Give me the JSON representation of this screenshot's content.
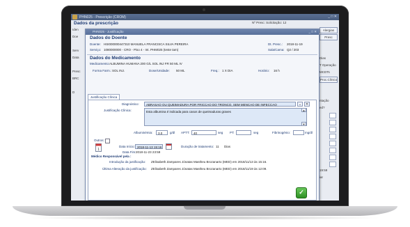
{
  "background_window": {
    "title": "PHN025 - Prescrição (CROM)",
    "header": "Dados da prescrição",
    "top_label": "Nº Presc: Solicitação: 12",
    "left_items": [
      "Iden",
      "Doe",
      "",
      "Serv",
      "Data",
      "",
      "Presc",
      "BRC",
      "",
      "D"
    ],
    "right_items": [
      "Alergias",
      "Presc",
      "",
      "",
      "Dias",
      "T Operação",
      "MCDTs",
      "Proc.Clínico",
      "",
      "",
      "ntação",
      "ed?"
    ],
    "right_bottom": [
      "19:59",
      "iar"
    ]
  },
  "modal": {
    "title": "PHN025 - Justificação",
    "patient_section": {
      "title": "Dados do Doente",
      "patient_label": "Doente:",
      "patient_value": "HSI000000447310 MANUELA FRANCISCA SILVA PEREIRA",
      "date_label": "Dt. Presc.:",
      "date_value": "2018-11-19",
      "service_label": "Serviço:",
      "service_value": "1080000000 - CRO - Piso 4 - Int. PHM025 (teste tam)",
      "room_label": "Sala/Cama:",
      "room_value": "Q2 / 203"
    },
    "medication_section": {
      "title": "Dados do Medicamento",
      "med_label": "Medicamento:",
      "med_value": "ALBUMINA HUMANA 200 G/L SOL INJ FR 50 ML IV",
      "form_label": "Forma Farm.:",
      "form_value": "SOL INJ.",
      "dose_label": "Dose/Unidade:",
      "dose_value": "50 ML",
      "freq_label": "Freq.:",
      "freq_value": "1 X DIA",
      "time_label": "Horário:",
      "time_value": "16 h"
    },
    "tab_label": "Justificação Clínica",
    "diagnosis_label": "Diagnóstico:",
    "diagnosis_value": "ABRASAO OU QUEIMADURA POR FRICCAO DO TRONCO, SEM MENCAO DE INFECCAO",
    "justification_label": "Justificação Clínica:",
    "justification_value": "Esta albumina é indicada para casos de queimaduras graves",
    "labs": {
      "albumin_label": "Albuminémia:",
      "albumin_value": "3.0",
      "albumin_unit": "g/dl",
      "aptt_label": "APTT:",
      "aptt_value": "40",
      "aptt_unit": "seg",
      "pt_label": "PT:",
      "pt_value": "",
      "pt_unit": "seg",
      "fibrinogen_label": "Fibrinogénio:",
      "fibrinogen_value": "",
      "fibrinogen_unit": "mg/dl"
    },
    "others_label": "Outros:",
    "start_label": "Data Início:",
    "start_value": "2018-11-13 15:16",
    "duration_label": "Duração de tratamento:",
    "duration_value": "11",
    "duration_unit": "Dias",
    "end_label": "Data Fim:",
    "end_value": "2018-11-23 23:59",
    "responsible_label": "Médico Responsável pela :",
    "intro_label": "Introdução da justificação:",
    "intro_value": "ZElisabeth Zampares Jónatas Mastheu Brozanarto (MED)  em 2018/11/13 às 15:16.",
    "last_change_label": "Última Alteração da justificação:",
    "last_change_value": "ZElisabeth Zampares Jónatas Mastheu Brozanarto (MED)  em 2018/11/19 às 12:09.",
    "ok_icon": "check-icon",
    "window_controls": "_ □ ✕"
  }
}
